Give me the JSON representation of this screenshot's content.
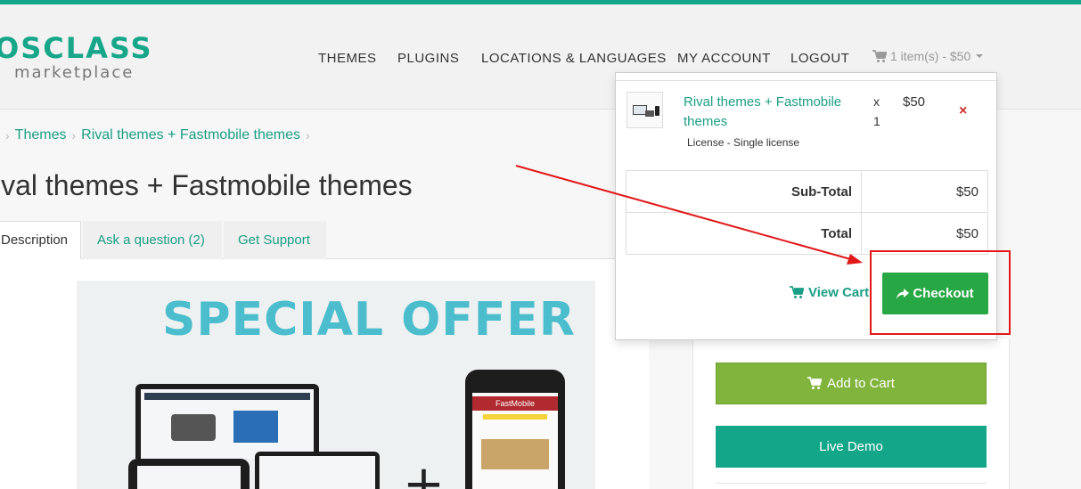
{
  "logo": {
    "main": "OSCLASS",
    "sub": "marketplace"
  },
  "nav": {
    "themes": "THEMES",
    "plugins": "PLUGINS",
    "locations": "LOCATIONS & LANGUAGES",
    "account": "MY ACCOUNT",
    "logout": "LOGOUT",
    "cart": "1 item(s) - $50"
  },
  "breadcrumb": [
    "Themes",
    "Rival themes + Fastmobile themes"
  ],
  "page_title": "ival themes + Fastmobile themes",
  "tabs": {
    "description": "Description",
    "ask": "Ask a question (2)",
    "support": "Get Support"
  },
  "promo": {
    "title": "SPECIAL OFFER",
    "mobile_label": "FastMobile"
  },
  "cart_dropdown": {
    "item_name": "Rival themes + Fastmobile themes",
    "license": "License - Single license",
    "qty_x": "x",
    "qty": "1",
    "price": "$50",
    "remove": "×",
    "subtotal_label": "Sub-Total",
    "subtotal_value": "$50",
    "total_label": "Total",
    "total_value": "$50",
    "view_cart": "View Cart",
    "checkout": "Checkout"
  },
  "sidebar": {
    "add_to_cart": "Add to Cart",
    "live_demo": "Live Demo"
  },
  "icons": {
    "cart": "shopping-cart-icon",
    "share": "share-arrow-icon",
    "remove": "close-icon",
    "breadcrumb_sep": "chevron-right-icon"
  },
  "colors": {
    "brand": "#13a689",
    "link": "#1a9e85",
    "checkout": "#28a745",
    "add_to_cart": "#80b43d",
    "annotation": "#e01818"
  }
}
